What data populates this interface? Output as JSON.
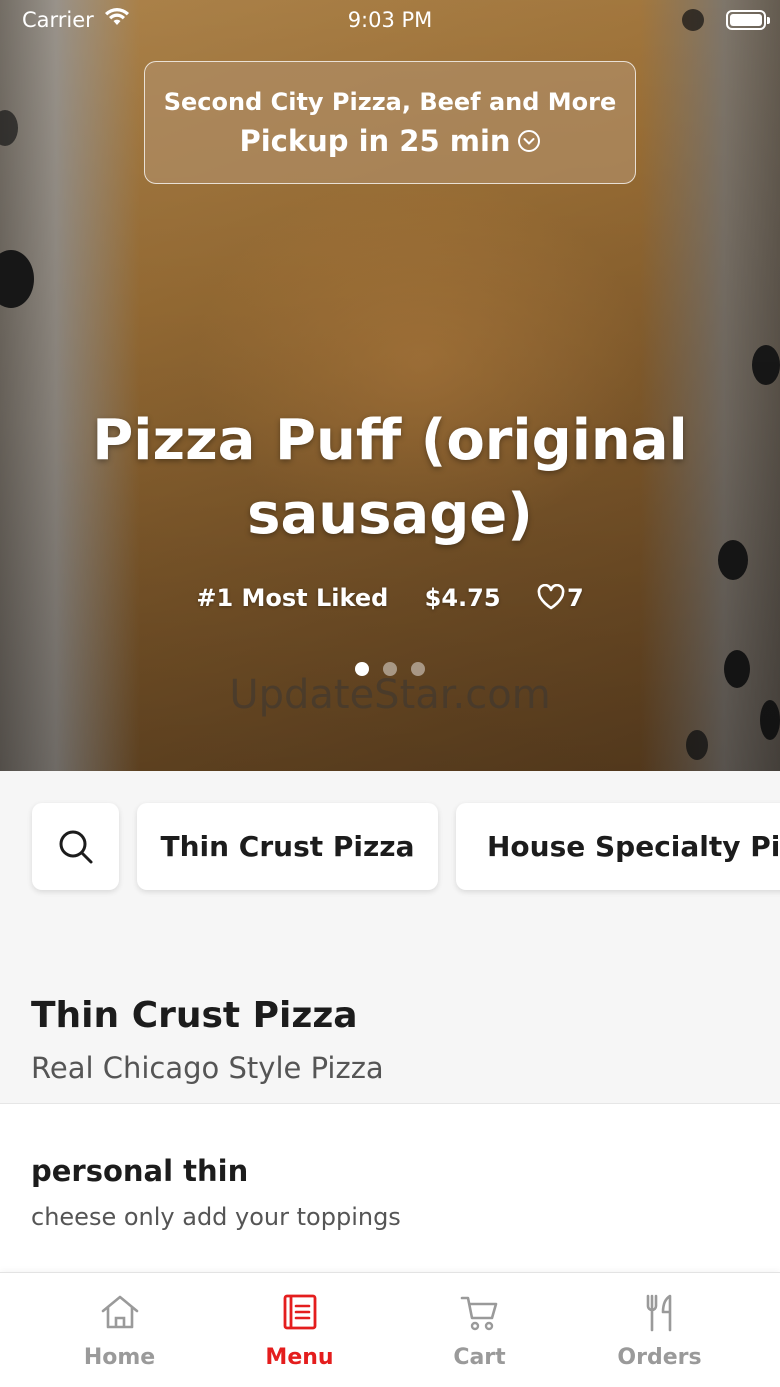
{
  "status_bar": {
    "carrier": "Carrier",
    "time": "9:03 PM"
  },
  "pickup": {
    "store_name": "Second City Pizza, Beef and More",
    "eta": "Pickup in 25 min"
  },
  "featured": {
    "name": "Pizza Puff (original sausage)",
    "rank": "#1 Most Liked",
    "price": "$4.75",
    "likes": "7",
    "carousel": {
      "count": 3,
      "active_index": 0
    },
    "watermark": "UpdateStar.com"
  },
  "categories": {
    "search_icon": "search-icon",
    "chips": [
      "Thin Crust Pizza",
      "House Specialty Pizza"
    ]
  },
  "section": {
    "title": "Thin Crust Pizza",
    "subtitle": "Real Chicago Style Pizza"
  },
  "items": [
    {
      "name": "personal thin",
      "description": "cheese only add your toppings"
    }
  ],
  "tabbar": {
    "active": "Menu",
    "tabs": [
      {
        "label": "Home",
        "icon": "home-icon"
      },
      {
        "label": "Menu",
        "icon": "menu-icon"
      },
      {
        "label": "Cart",
        "icon": "cart-icon"
      },
      {
        "label": "Orders",
        "icon": "fork-knife-icon"
      }
    ]
  },
  "colors": {
    "accent": "#e41d1d",
    "inactive_tab": "#9a9a9a"
  }
}
